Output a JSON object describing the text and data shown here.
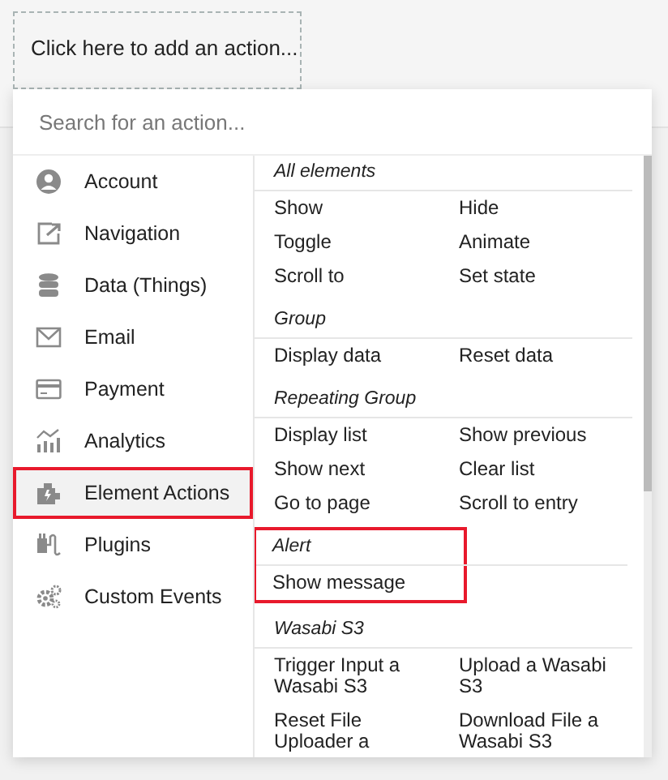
{
  "action_slot": {
    "text": "Click here to add an action..."
  },
  "search": {
    "placeholder": "Search for an action..."
  },
  "categories": [
    {
      "label": "Account",
      "selected": false,
      "highlighted": false
    },
    {
      "label": "Navigation",
      "selected": false,
      "highlighted": false
    },
    {
      "label": "Data (Things)",
      "selected": false,
      "highlighted": false
    },
    {
      "label": "Email",
      "selected": false,
      "highlighted": false
    },
    {
      "label": "Payment",
      "selected": false,
      "highlighted": false
    },
    {
      "label": "Analytics",
      "selected": false,
      "highlighted": false
    },
    {
      "label": "Element Actions",
      "selected": true,
      "highlighted": true
    },
    {
      "label": "Plugins",
      "selected": false,
      "highlighted": false
    },
    {
      "label": "Custom Events",
      "selected": false,
      "highlighted": false
    }
  ],
  "sections": [
    {
      "title": "All elements",
      "highlighted": false,
      "actions": [
        "Show",
        "Hide",
        "Toggle",
        "Animate",
        "Scroll to",
        "Set state"
      ]
    },
    {
      "title": "Group",
      "highlighted": false,
      "actions": [
        "Display data",
        "Reset data"
      ]
    },
    {
      "title": "Repeating Group",
      "highlighted": false,
      "actions": [
        "Display list",
        "Show previous",
        "Show next",
        "Clear list",
        "Go to page",
        "Scroll to entry"
      ]
    },
    {
      "title": "Alert",
      "highlighted": true,
      "actions": [
        "Show message"
      ]
    },
    {
      "title": "Wasabi S3",
      "highlighted": false,
      "actions": [
        "Trigger Input a Wasabi S3",
        "Upload a Wasabi S3",
        "Reset File Uploader a",
        "Download File a Wasabi S3"
      ]
    }
  ]
}
